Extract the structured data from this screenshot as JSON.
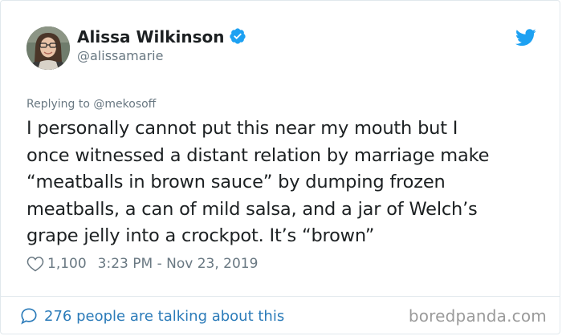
{
  "author": {
    "display_name": "Alissa Wilkinson",
    "handle": "@alissamarie",
    "verified": true,
    "verified_color": "#1da1f2"
  },
  "icons": {
    "verified": "verified-badge-icon",
    "brand": "twitter-bird-icon",
    "like": "heart-icon",
    "conversation": "speech-bubble-icon"
  },
  "reply": {
    "prefix": "Replying to",
    "to": "@mekosoff"
  },
  "tweet": {
    "lines": [
      "I personally cannot put this near my mouth but I",
      "once witnessed a distant relation by marriage make",
      "“meatballs in brown sauce” by dumping frozen",
      "meatballs, a can of mild salsa, and a jar of Welch’s",
      "grape jelly into a crockpot. It’s “brown”"
    ]
  },
  "meta": {
    "likes": "1,100",
    "timestamp": "3:23 PM - Nov 23, 2019"
  },
  "footer": {
    "conversation": "276 people are talking about this",
    "watermark": "boredpanda.com"
  },
  "colors": {
    "brand_blue": "#1da1f2",
    "link_blue": "#2b7bb9",
    "muted_gray": "#697882",
    "text": "#1c2022",
    "border": "#e1e8ed"
  }
}
